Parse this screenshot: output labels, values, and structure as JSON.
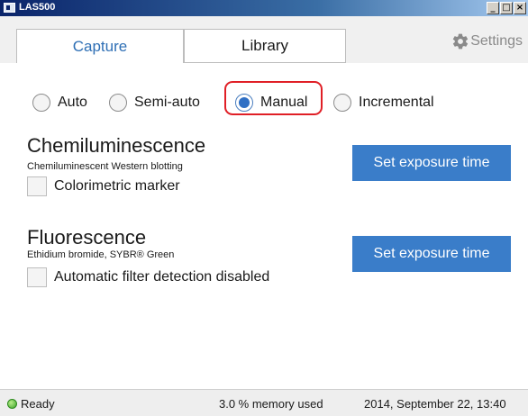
{
  "window": {
    "title": "LAS500",
    "minimize_glyph": "_",
    "maximize_glyph": "□",
    "close_glyph": "×"
  },
  "tabs": [
    {
      "label": "Capture",
      "active": true
    },
    {
      "label": "Library",
      "active": false
    }
  ],
  "settings": {
    "label": "Settings",
    "icon": "gear-icon"
  },
  "modes": {
    "options": [
      "Auto",
      "Semi-auto",
      "Manual",
      "Incremental"
    ],
    "selected": "Manual",
    "highlight_color": "#e01f26"
  },
  "chemiluminescence": {
    "title": "Chemiluminescence",
    "subtitle": "Chemiluminescent Western blotting",
    "checkbox_label": "Colorimetric marker",
    "checked": false,
    "button_label": "Set exposure time"
  },
  "fluorescence": {
    "title": "Fluorescence",
    "subtitle": "Ethidium bromide, SYBR® Green",
    "checkbox_label": "Automatic filter detection disabled",
    "checked": false,
    "button_label": "Set exposure time"
  },
  "status": {
    "ready": "Ready",
    "memory": "3.0 % memory used",
    "datetime": "2014, September 22, 13:40"
  },
  "colors": {
    "accent": "#2e6fb5",
    "button_bg": "#3a7dc9",
    "status_ok": "#3ca328"
  }
}
